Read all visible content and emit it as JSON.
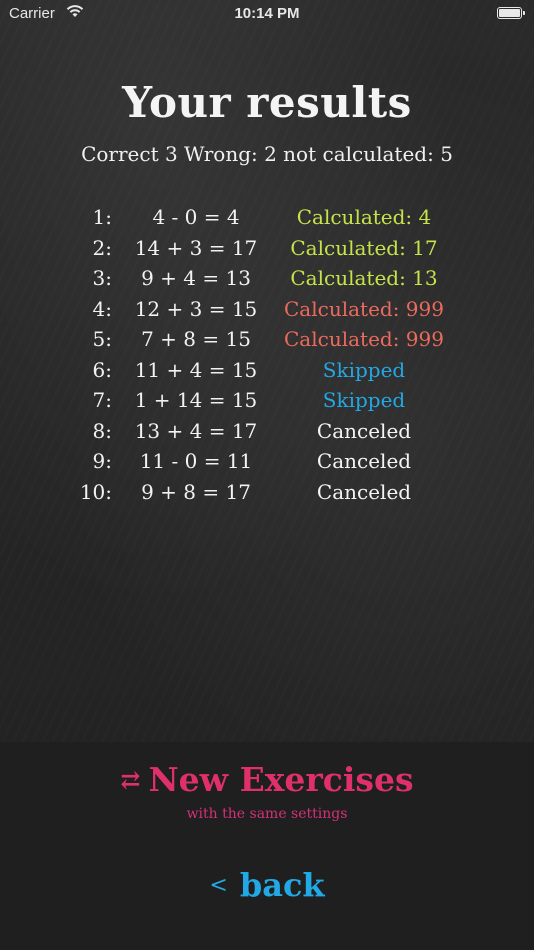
{
  "status_bar": {
    "carrier": "Carrier",
    "time": "10:14 PM"
  },
  "title": "Your results",
  "summary": "Correct 3 Wrong: 2 not calculated: 5",
  "colors": {
    "correct": "#c6e34a",
    "wrong": "#ec6a5e",
    "skipped": "#23a8e6",
    "canceled": "#f4f4f4",
    "accent": "#e0306a"
  },
  "results": [
    {
      "index": "1:",
      "expression": "4 - 0 = 4",
      "status": "Calculated: 4",
      "kind": "correct"
    },
    {
      "index": "2:",
      "expression": "14 + 3 = 17",
      "status": "Calculated: 17",
      "kind": "correct"
    },
    {
      "index": "3:",
      "expression": "9 + 4 = 13",
      "status": "Calculated: 13",
      "kind": "correct"
    },
    {
      "index": "4:",
      "expression": "12 + 3 = 15",
      "status": "Calculated: 999",
      "kind": "wrong"
    },
    {
      "index": "5:",
      "expression": "7 + 8 = 15",
      "status": "Calculated: 999",
      "kind": "wrong"
    },
    {
      "index": "6:",
      "expression": "11 + 4 = 15",
      "status": "Skipped",
      "kind": "skipped"
    },
    {
      "index": "7:",
      "expression": "1 + 14 = 15",
      "status": "Skipped",
      "kind": "skipped"
    },
    {
      "index": "8:",
      "expression": "13 + 4 = 17",
      "status": "Canceled",
      "kind": "canceled"
    },
    {
      "index": "9:",
      "expression": "11 - 0 = 11",
      "status": "Canceled",
      "kind": "canceled"
    },
    {
      "index": "10:",
      "expression": "9 + 8 = 17",
      "status": "Canceled",
      "kind": "canceled"
    }
  ],
  "actions": {
    "new_exercises_label": "New Exercises",
    "new_exercises_icon": "repeat-icon",
    "new_exercises_sub": "with the same settings",
    "back_label": "back",
    "back_icon": "chevron-left-icon"
  }
}
